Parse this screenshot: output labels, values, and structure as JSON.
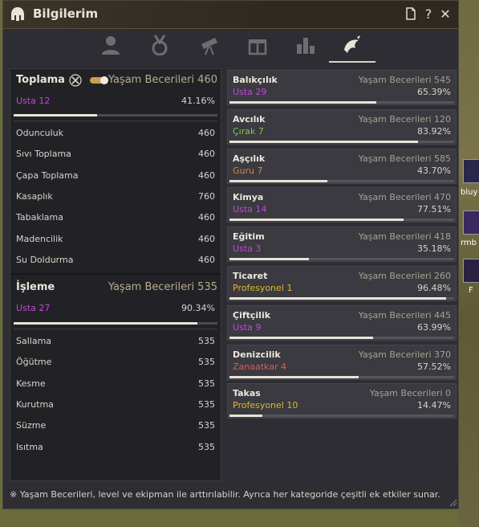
{
  "window": {
    "title": "Bilgilerim",
    "title_icon": "helmet-icon",
    "buttons": [
      "page-icon",
      "help-icon",
      "close-icon"
    ],
    "help_glyph": "?",
    "close_glyph": "✕"
  },
  "tabs": [
    {
      "icon": "profile-icon",
      "active": false
    },
    {
      "icon": "medal-icon",
      "active": false
    },
    {
      "icon": "telescope-icon",
      "active": false
    },
    {
      "icon": "gift-icon",
      "active": false
    },
    {
      "icon": "bar-chart-icon",
      "active": false
    },
    {
      "icon": "life-skill-icon",
      "active": true
    }
  ],
  "left": {
    "gathering": {
      "title": "Toplama",
      "icon": "crossed-tools-icon",
      "skill_text": "Yaşam Becerileri 460",
      "rank": "Usta 12",
      "percent": "41.16%",
      "progress": 0.41,
      "items": [
        {
          "name": "Odunculuk",
          "value": "460"
        },
        {
          "name": "Sıvı Toplama",
          "value": "460"
        },
        {
          "name": "Çapa Toplama",
          "value": "460"
        },
        {
          "name": "Kasaplık",
          "value": "760"
        },
        {
          "name": "Tabaklama",
          "value": "460"
        },
        {
          "name": "Madencilik",
          "value": "460"
        },
        {
          "name": "Su Doldurma",
          "value": "460"
        }
      ]
    },
    "processing": {
      "title": "İşleme",
      "skill_text": "Yaşam Becerileri 535",
      "rank": "Usta 27",
      "percent": "90.34%",
      "progress": 0.9034,
      "items": [
        {
          "name": "Sallama",
          "value": "535"
        },
        {
          "name": "Öğütme",
          "value": "535"
        },
        {
          "name": "Kesme",
          "value": "535"
        },
        {
          "name": "Kurutma",
          "value": "535"
        },
        {
          "name": "Süzme",
          "value": "535"
        },
        {
          "name": "Isıtma",
          "value": "535"
        }
      ]
    }
  },
  "skills": [
    {
      "name": "Balıkçılık",
      "skill": "Yaşam Becerileri 545",
      "rank": "Usta 29",
      "rank_color": "#c048d8",
      "percent": "65.39%",
      "progress": 0.6539
    },
    {
      "name": "Avcılık",
      "skill": "Yaşam Becerileri 120",
      "rank": "Çırak 7",
      "rank_color": "#7ec850",
      "percent": "83.92%",
      "progress": 0.8392
    },
    {
      "name": "Aşçılık",
      "skill": "Yaşam Becerileri 585",
      "rank": "Guru 7",
      "rank_color": "#e08040",
      "percent": "43.70%",
      "progress": 0.437
    },
    {
      "name": "Kimya",
      "skill": "Yaşam Becerileri 470",
      "rank": "Usta 14",
      "rank_color": "#c048d8",
      "percent": "77.51%",
      "progress": 0.7751
    },
    {
      "name": "Eğitim",
      "skill": "Yaşam Becerileri 418",
      "rank": "Usta 3",
      "rank_color": "#c048d8",
      "percent": "35.18%",
      "progress": 0.3518
    },
    {
      "name": "Ticaret",
      "skill": "Yaşam Becerileri 260",
      "rank": "Profesyonel 1",
      "rank_color": "#e0b830",
      "percent": "96.48%",
      "progress": 0.9648
    },
    {
      "name": "Çiftçilik",
      "skill": "Yaşam Becerileri 445",
      "rank": "Usta 9",
      "rank_color": "#c048d8",
      "percent": "63.99%",
      "progress": 0.6399
    },
    {
      "name": "Denizcilik",
      "skill": "Yaşam Becerileri 370",
      "rank": "Zanaatkar 4",
      "rank_color": "#e05858",
      "percent": "57.52%",
      "progress": 0.5752
    },
    {
      "name": "Takas",
      "skill": "Yaşam Becerileri 0",
      "rank": "Profesyonel 10",
      "rank_color": "#e0b830",
      "percent": "14.47%",
      "progress": 0.1447
    }
  ],
  "footer": "※ Yaşam Becerileri, level ve ekipman ile arttırılabilir. Ayrıca her kategoride çeşitli ek etkiler sunar.",
  "world_labels": [
    "bluy",
    "rmb",
    "F"
  ]
}
